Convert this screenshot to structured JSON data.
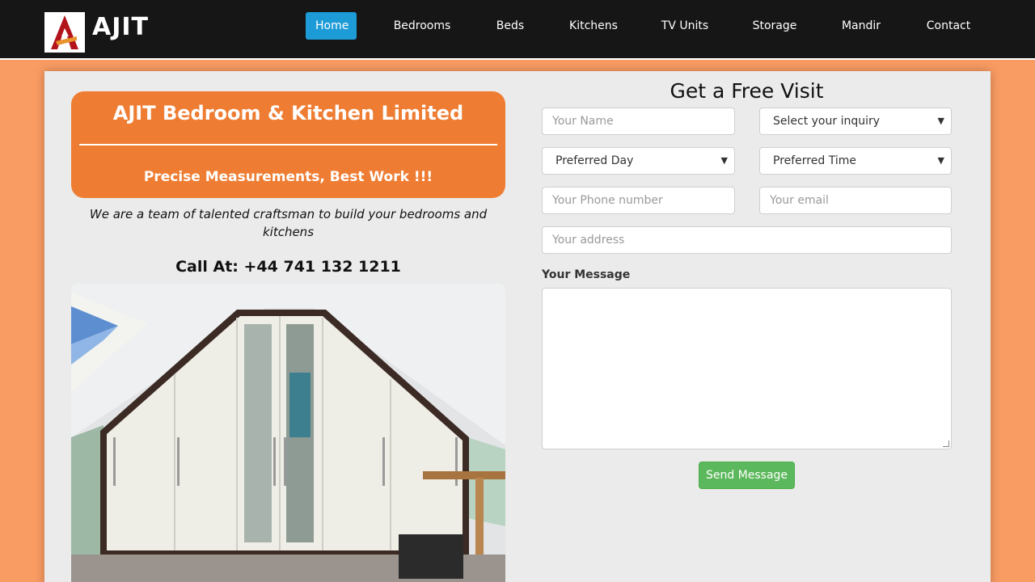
{
  "brand": {
    "name": "AJIT",
    "logo_icon": "ajit-logo-icon"
  },
  "nav": {
    "items": [
      {
        "label": "Home",
        "active": true
      },
      {
        "label": "Bedrooms",
        "active": false
      },
      {
        "label": "Beds",
        "active": false
      },
      {
        "label": "Kitchens",
        "active": false
      },
      {
        "label": "TV Units",
        "active": false
      },
      {
        "label": "Storage",
        "active": false
      },
      {
        "label": "Mandir",
        "active": false
      },
      {
        "label": "Contact",
        "active": false
      }
    ]
  },
  "hero": {
    "title": "AJIT Bedroom & Kitchen Limited",
    "subtitle": "Precise Measurements, Best Work !!!",
    "tagline": "We are a team of talented craftsman to build your bedrooms and kitchens",
    "call": "Call At: +44 741 132 1211"
  },
  "form": {
    "title": "Get a Free Visit",
    "name_placeholder": "Your Name",
    "inquiry_select": "Select your inquiry",
    "day_select": "Preferred Day",
    "time_select": "Preferred Time",
    "phone_placeholder": "Your Phone number",
    "email_placeholder": "Your email",
    "address_placeholder": "Your address",
    "message_label": "Your Message",
    "submit_label": "Send Message"
  },
  "colors": {
    "page_bg": "#f99c63",
    "navbar": "#161616",
    "nav_active": "#1d9bd7",
    "hero_orange": "#ee7d33",
    "submit_green": "#5cb85c"
  }
}
